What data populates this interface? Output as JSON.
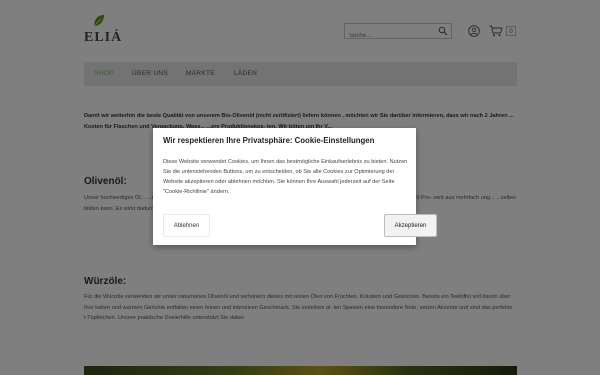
{
  "header": {
    "logo_text": "ELIÁ",
    "search_placeholder": "Suche...",
    "cart_count": "0"
  },
  "nav": {
    "items": [
      {
        "label": "SHOP",
        "active": true
      },
      {
        "label": "ÜBER UNS"
      },
      {
        "label": "MÄRKTE"
      },
      {
        "label": "LÄDEN"
      }
    ],
    "active_color": "#7cb342"
  },
  "content": {
    "intro": "Damit wir weiterhin die beste Qualität von unserem Bio-Olivenöl (nicht zertifiziert) liefern können , möchten wir Sie darüber informieren, dass wir nach 2 Jahren ... Kosten für Flaschen und Verpackung, Wass... ...ere Produktionskos- ten. Wir bitten um Ihr V...",
    "section1_title": "Olivenöl:",
    "section1_text": "Unser hochwertiges Ol... ...epresst und ungefil- tert gelagert. Durch di... ...alten. Bei uns bestel- len Sie keine Massenw... ...d zu rund 10 Pro- zent aus mehrfach ung... ...selber bilden kann. Es wirkt dadurch sehr gesundheitsfördernd und lebensverlängernd.",
    "section2_title": "Würzöle:",
    "section2_text": "Für die Würzöle verwenden wir unser naturreines Olivenöl und verfeinern dieses mit reinen Ölen von Früchten, Kräutern und Gewürzen. Bereits ein Teelöffel voll davon über Ihre kalten und warmen Gerichte entfalten einen feinen und intensiven Geschmack. Sie verleihen al- len Speisen eine besondere Note, setzen Akzente und sind das perfekte i-Tüpfelchen. Unsere praktische Dosierhilfe unterstützt Sie dabei."
  },
  "cookie_modal": {
    "title": "Wir respektieren Ihre Privatsphäre: Cookie-Einstellungen",
    "text": "Diese Website verwendet Cookies, um Ihnen das bestmögliche Einkaufserlebnis zu bieten. Nutzen Sie die untenstehenden Buttons, um zu entscheiden, ob Sie alle Cookies zur Optimierung der Website akzeptieren oder ablehnen möchten. Sie können Ihre Auswahl jederzeit auf der Seite \"Cookie-Richtlinie\" ändern.",
    "decline_label": "Ablehnen",
    "accept_label": "Akzeptieren"
  },
  "icons": [
    "leaf-icon",
    "search-icon",
    "user-icon",
    "cart-icon"
  ]
}
